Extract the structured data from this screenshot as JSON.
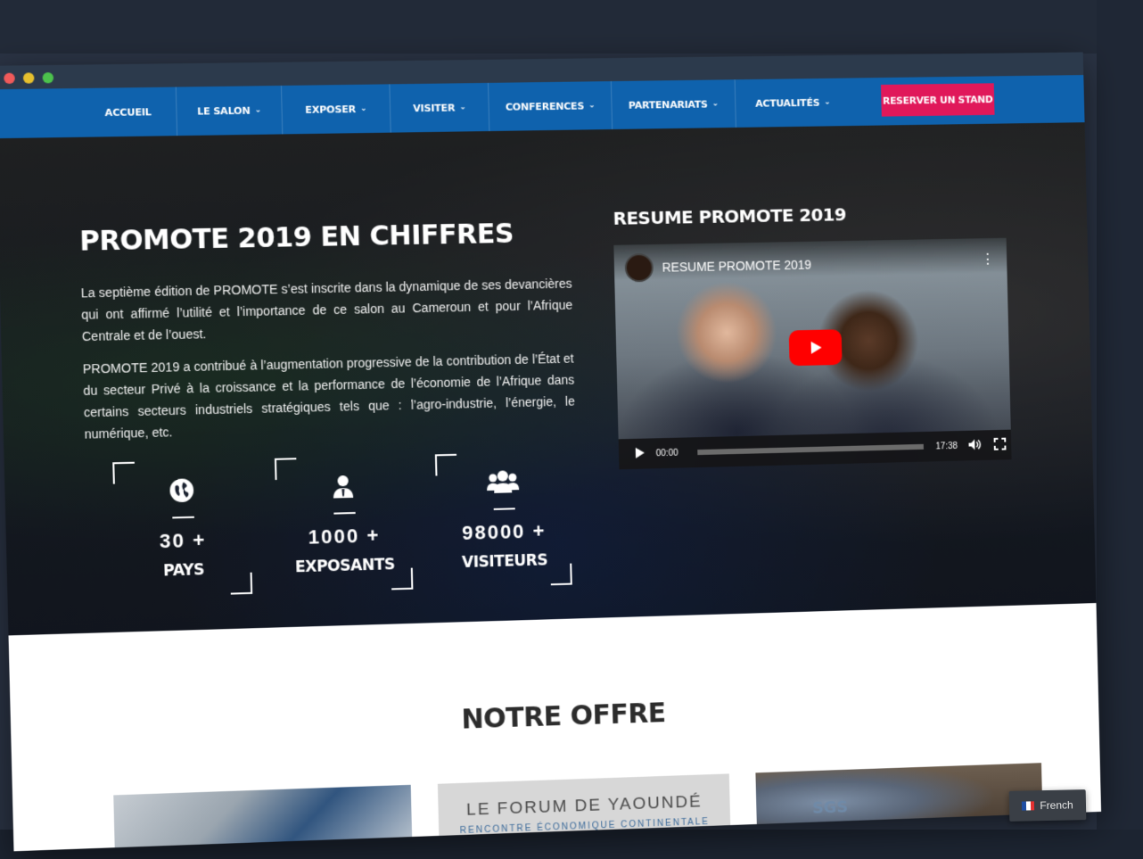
{
  "window": {
    "controls": [
      "close",
      "minimize",
      "maximize"
    ]
  },
  "nav": {
    "items": [
      {
        "label": "ACCUEIL",
        "dropdown": false
      },
      {
        "label": "LE SALON",
        "dropdown": true
      },
      {
        "label": "EXPOSER",
        "dropdown": true
      },
      {
        "label": "VISITER",
        "dropdown": true
      },
      {
        "label": "CONFERENCES",
        "dropdown": true
      },
      {
        "label": "PARTENARIATS",
        "dropdown": true
      },
      {
        "label": "ACTUALITÉS",
        "dropdown": true
      }
    ],
    "cta_label": "RESERVER UN STAND",
    "bar_color": "#0f62ad",
    "cta_color": "#e0185a"
  },
  "hero": {
    "title": "PROMOTE 2019 EN CHIFFRES",
    "paragraph1": "La septième édition de PROMOTE s’est inscrite dans la dynamique de ses devancières qui ont affirmé l’utilité et l’importance de ce salon au Cameroun et pour l’Afrique Centrale et de l’ouest.",
    "paragraph2": "PROMOTE 2019 a contribué à l’augmentation progressive de la contribution de l’État et du secteur Privé à la croissance et la performance de l’économie de l’Afrique dans certains secteurs industriels stratégiques tels que : l’agro-industrie, l’énergie, le numérique, etc.",
    "stats": [
      {
        "icon": "globe-icon",
        "value": "30 +",
        "label": "PAYS"
      },
      {
        "icon": "user-icon",
        "value": "1000 +",
        "label": "EXPOSANTS"
      },
      {
        "icon": "users-icon",
        "value": "98000 +",
        "label": "VISITEURS"
      }
    ]
  },
  "video": {
    "heading": "RESUME PROMOTE 2019",
    "embed_title": "RESUME PROMOTE 2019",
    "current_time": "00:00",
    "duration": "17:38"
  },
  "offer": {
    "title": "NOTRE OFFRE",
    "cards": [
      {
        "image": "exhibition-hall-photo"
      },
      {
        "line1": "LE FORUM DE YAOUNDÉ",
        "line2": "RENCONTRE ÉCONOMIQUE CONTINENTALE"
      },
      {
        "sign": "SGS"
      }
    ]
  },
  "language": {
    "label": "French"
  }
}
